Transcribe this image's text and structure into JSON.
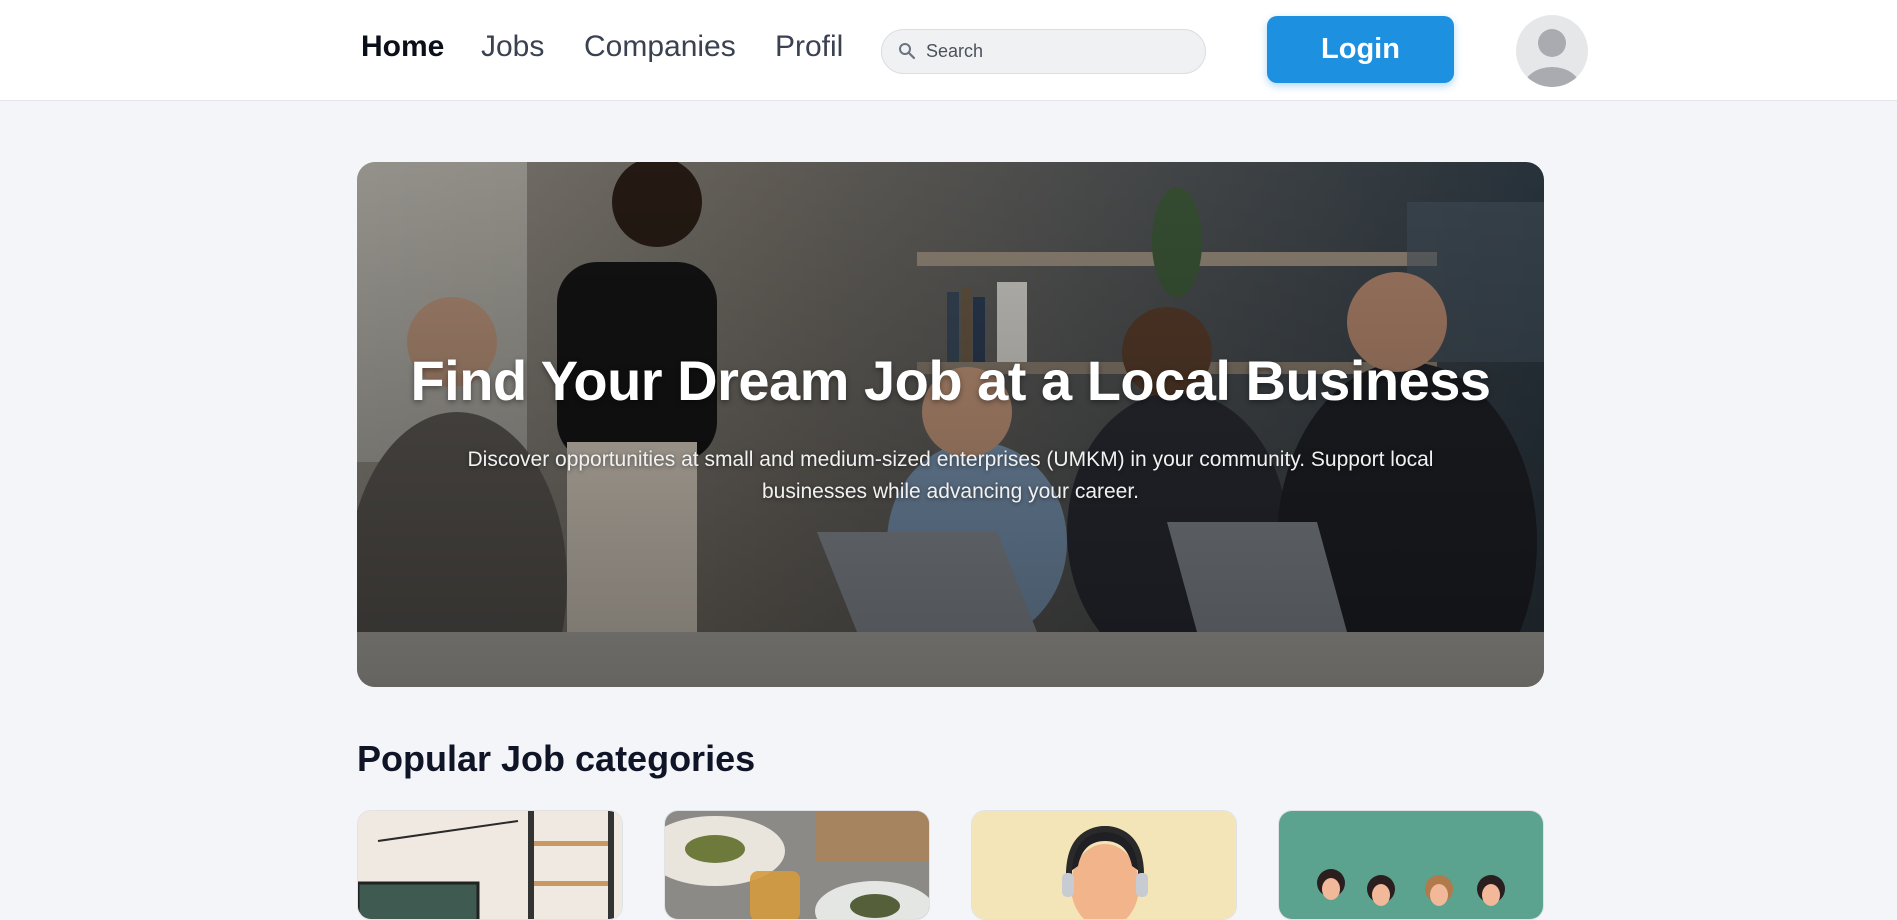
{
  "nav": {
    "links": [
      {
        "label": "Home",
        "active": true
      },
      {
        "label": "Jobs",
        "active": false
      },
      {
        "label": "Companies",
        "active": false
      },
      {
        "label": "Profil",
        "active": false
      }
    ],
    "search_placeholder": "Search",
    "login_label": "Login",
    "icons": {
      "search": "search-icon",
      "avatar": "user-avatar-icon"
    }
  },
  "hero": {
    "title": "Find Your Dream Job at a Local Business",
    "subtitle": "Discover opportunities at small and medium-sized enterprises (UMKM) in your community. Support local businesses while advancing your career."
  },
  "categories_section": {
    "title": "Popular Job categories"
  },
  "colors": {
    "accent": "#1e90e0",
    "page_bg": "#f4f5f9",
    "heading": "#0f1526"
  }
}
